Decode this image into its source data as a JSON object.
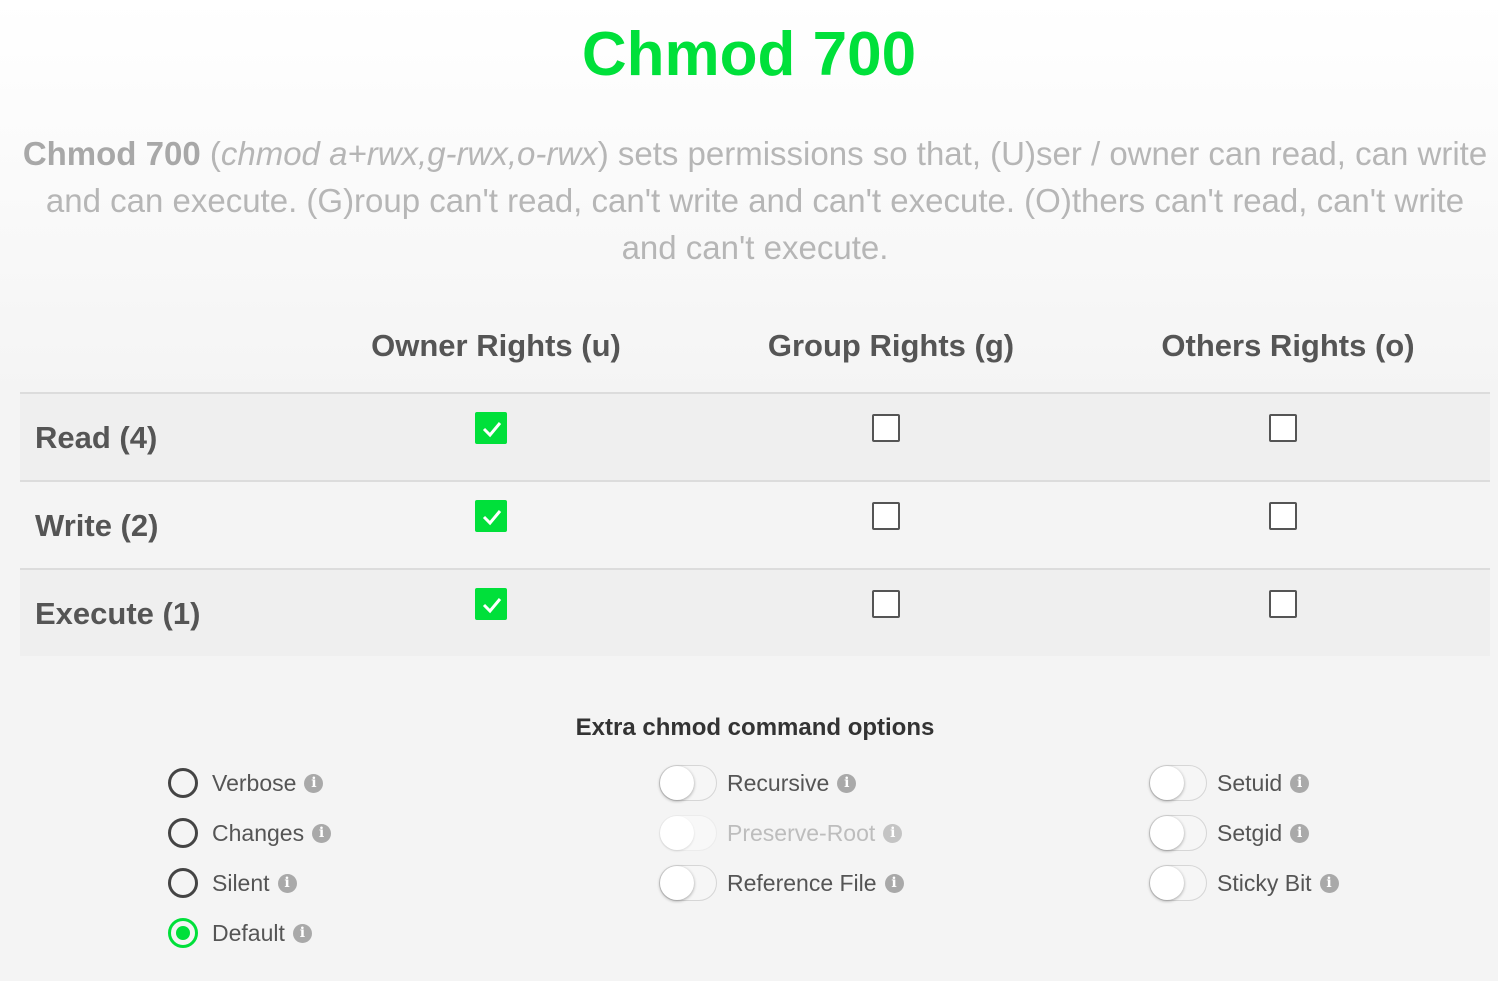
{
  "title": "Chmod 700",
  "description": {
    "bold": "Chmod 700",
    "open_paren": " (",
    "italic": "chmod a+rwx,g-rwx,o-rwx",
    "rest": ") sets permissions so that, (U)ser / owner can read, can write and can execute. (G)roup can't read, can't write and can't execute. (O)thers can't read, can't write and can't execute."
  },
  "columns": [
    "Owner Rights (u)",
    "Group Rights (g)",
    "Others Rights (o)"
  ],
  "rows": [
    {
      "label": "Read (4)",
      "owner": true,
      "group": false,
      "others": false
    },
    {
      "label": "Write (2)",
      "owner": true,
      "group": false,
      "others": false
    },
    {
      "label": "Execute (1)",
      "owner": true,
      "group": false,
      "others": false
    }
  ],
  "extra": {
    "title": "Extra chmod command options",
    "radios": [
      {
        "label": "Verbose",
        "selected": false
      },
      {
        "label": "Changes",
        "selected": false
      },
      {
        "label": "Silent",
        "selected": false
      },
      {
        "label": "Default",
        "selected": true
      }
    ],
    "toggles_mid": [
      {
        "label": "Recursive",
        "on": false,
        "disabled": false
      },
      {
        "label": "Preserve-Root",
        "on": false,
        "disabled": true
      },
      {
        "label": "Reference File",
        "on": false,
        "disabled": false
      }
    ],
    "toggles_right": [
      {
        "label": "Setuid",
        "on": false
      },
      {
        "label": "Setgid",
        "on": false
      },
      {
        "label": "Sticky Bit",
        "on": false
      }
    ],
    "info_glyph": "i"
  },
  "colors": {
    "accent": "#00e03a",
    "text": "#555555",
    "muted": "#b6b6b6"
  }
}
